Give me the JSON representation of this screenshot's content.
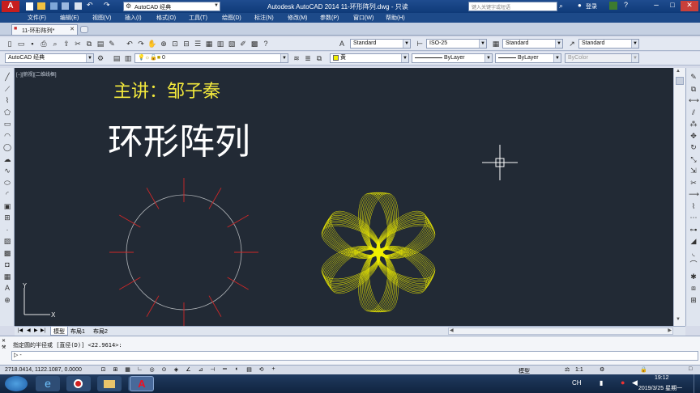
{
  "titlebar": {
    "workspace": "AutoCAD 经典",
    "app_title": "Autodesk AutoCAD 2014    11-环形阵列.dwg - 只读",
    "search_placeholder": "键入关键字或短语",
    "login": "登录"
  },
  "menus": [
    "文件(F)",
    "编辑(E)",
    "视图(V)",
    "插入(I)",
    "格式(O)",
    "工具(T)",
    "绘图(D)",
    "标注(N)",
    "修改(M)",
    "参数(P)",
    "窗口(W)",
    "帮助(H)"
  ],
  "doc_tab": "11-环形阵列*",
  "styles": {
    "text_style": "Standard",
    "dim_style": "ISO-25",
    "table_style": "Standard",
    "mleader_style": "Standard"
  },
  "toolbar3": {
    "workspace": "AutoCAD 经典",
    "layer": "0",
    "color": "黄",
    "linetype": "ByLayer",
    "lineweight": "ByLayer",
    "plotstyle": "ByColor"
  },
  "viewport_label": "[−][俯视][二维线框]",
  "drawing": {
    "subtitle": "主讲：邹子秦",
    "title": "环形阵列"
  },
  "layout_tabs": [
    "模型",
    "布局1",
    "布局2"
  ],
  "command": {
    "history": "指定圆的半径或 [直径(D)] <22.9614>:",
    "prompt": ""
  },
  "status": {
    "coords": "2718.0414, 1122.1087, 0.0000",
    "model": "模型",
    "scale": "1:1"
  },
  "taskbar": {
    "time": "19:12",
    "date": "2019/3/25 星期一"
  },
  "colors": {
    "canvas": "#222a35",
    "circle": "#b0b4b8",
    "red_lines": "#d02828",
    "flower": "#f2f000",
    "title_text": "#ffffff",
    "subtitle_text": "#f2e83c"
  }
}
